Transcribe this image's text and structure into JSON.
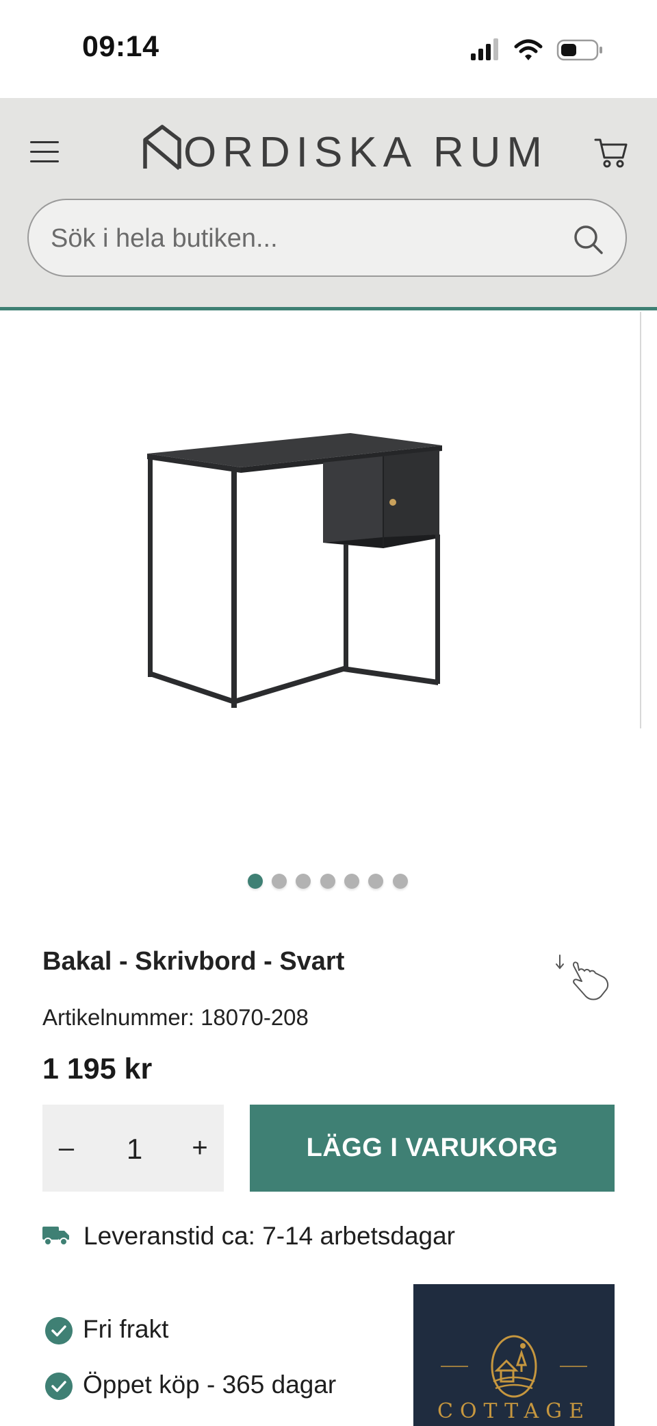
{
  "status_bar": {
    "time": "09:14"
  },
  "header": {
    "logo_text": "ORDISKA RUM",
    "search_placeholder": "Sök i hela butiken..."
  },
  "gallery": {
    "image_count": 7,
    "active_index": 0
  },
  "product": {
    "title": "Bakal - Skrivbord - Svart",
    "article_label": "Artikelnummer:",
    "article_number": "18070-208",
    "price": "1 195 kr",
    "quantity": "1",
    "minus_label": "–",
    "plus_label": "+",
    "add_to_cart_label": "LÄGG I VARUKORG"
  },
  "delivery": {
    "text": "Leveranstid ca: 7-14 arbetsdagar",
    "icon": "truck-icon"
  },
  "usps": [
    {
      "text": "Fri frakt",
      "icon": "check-circle-icon"
    },
    {
      "text": "Öppet köp - 365 dagar",
      "icon": "check-circle-icon"
    }
  ],
  "badge": {
    "name": "COTTAGE"
  },
  "colors": {
    "accent": "#3f8074",
    "header_bg": "#e4e4e2",
    "badge_bg": "#1f2c3f",
    "badge_gold": "#c6973f"
  }
}
